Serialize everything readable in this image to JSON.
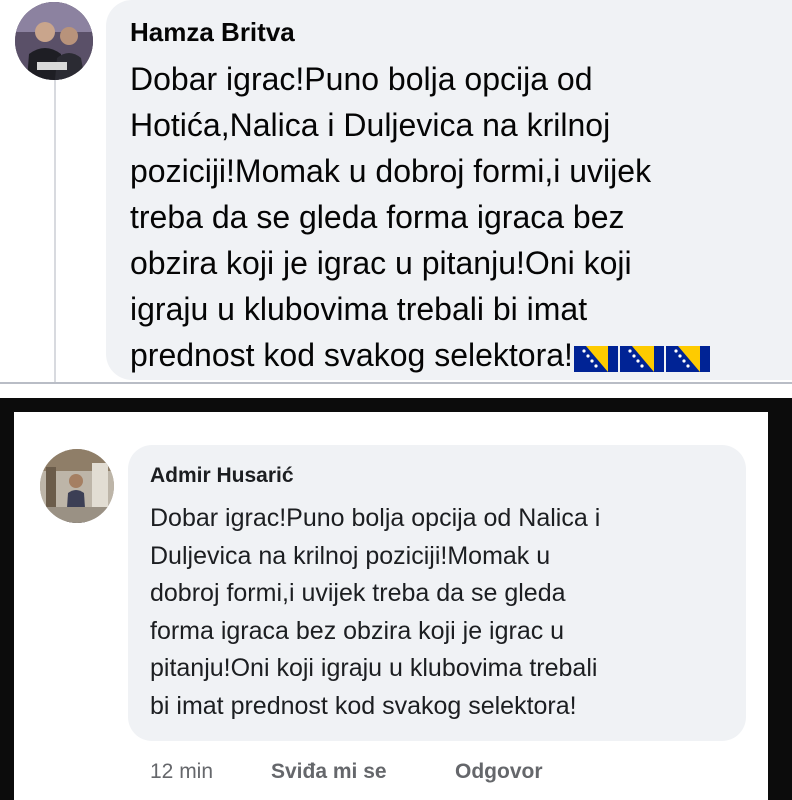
{
  "top_comment": {
    "author": "Hamza Britva",
    "lines": [
      "Dobar igrac!Puno bolja opcija od",
      "Hotića,Nalica i Duljevica na krilnoj",
      "poziciji!Momak u dobroj formi,i uvijek",
      "treba da se gleda forma igraca bez",
      "obzira koji je igrac u pitanju!Oni koji",
      "igraju u klubovima trebali bi imat",
      "prednost kod svakog selektora!"
    ],
    "emoji": [
      "bosnia-flag",
      "bosnia-flag",
      "bosnia-flag"
    ]
  },
  "bottom_comment": {
    "author": "Admir Husarić",
    "lines": [
      "Dobar igrac!Puno bolja opcija od Nalica i",
      "Duljevica na krilnoj poziciji!Momak u",
      "dobroj formi,i uvijek treba da se gleda",
      "forma igraca bez obzira koji je igrac u",
      "pitanju!Oni koji igraju u klubovima trebali",
      "bi imat prednost kod svakog selektora!"
    ],
    "time": "12 min",
    "like_label": "Sviđa mi se",
    "reply_label": "Odgovor"
  },
  "colors": {
    "bubble": "#f0f2f5",
    "text": "#050505",
    "meta": "#65676b",
    "flag_blue": "#002395",
    "flag_yellow": "#fecb00"
  }
}
